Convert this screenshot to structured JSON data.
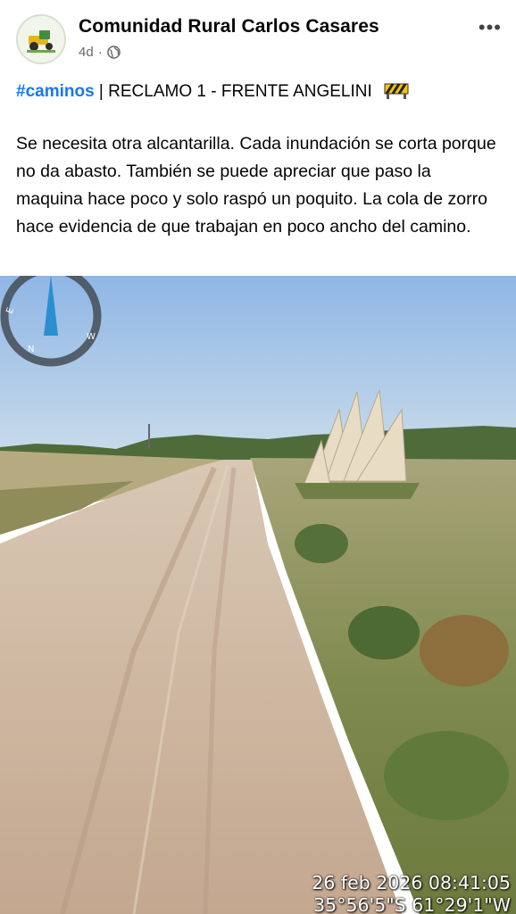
{
  "post": {
    "page_name": "Comunidad Rural Carlos Casares",
    "time": "4d",
    "time_separator": "·",
    "audience_icon": "globe-icon",
    "more_icon": "more-options-icon",
    "more_label": "•••",
    "hashtag": "#caminos",
    "title_text": " | RECLAMO 1 - FRENTE ANGELINI",
    "title_emoji": "construction-barrier-icon",
    "body": "Se necesita otra alcantarilla. Cada inundación se corta porque no da abasto. También se puede apreciar que paso la maquina hace poco y solo raspó un poquito. La cola de zorro hace evidencia de que trabajan en poco ancho del camino."
  },
  "photo": {
    "description_icon": "compass-icon",
    "compass_letters": {
      "e": "E",
      "n": "N",
      "w": "W"
    },
    "timestamp": "26 feb 2026 08:41:05",
    "coordinates": "35°56'5\"S 61°29'1\"W"
  },
  "colors": {
    "hashtag": "#1877f2",
    "sky_top": "#8fb6e6",
    "road": "#c9b09a",
    "grass": "#7a8a4a"
  }
}
